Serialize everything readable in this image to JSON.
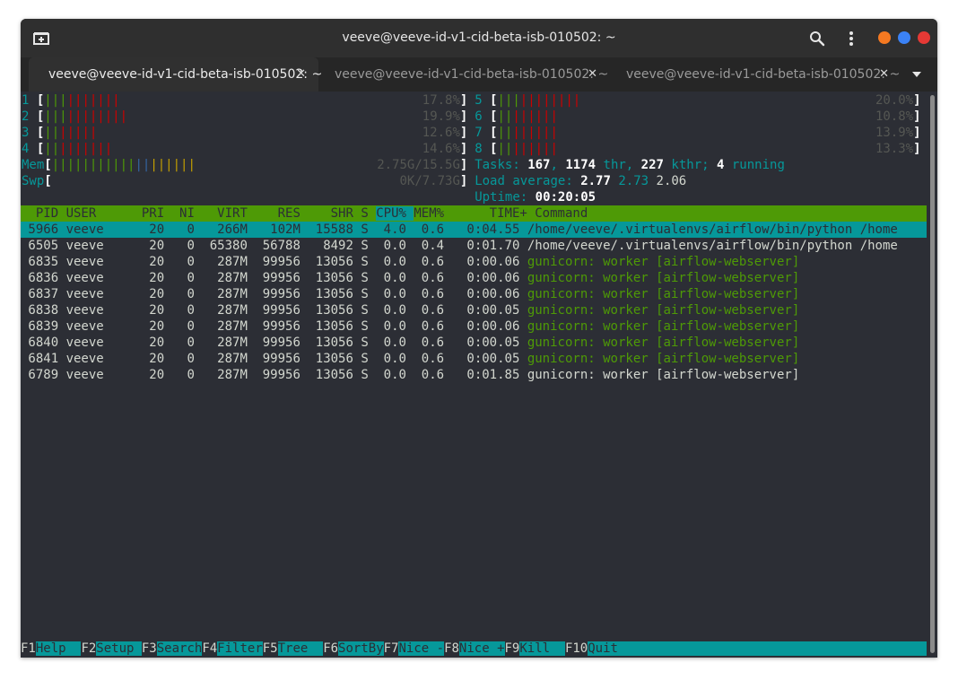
{
  "window": {
    "title": "veeve@veeve-id-v1-cid-beta-isb-010502: ~"
  },
  "tabs": [
    {
      "label": "veeve@veeve-id-v1-cid-beta-isb-010502: ~",
      "active": true
    },
    {
      "label": "veeve@veeve-id-v1-cid-beta-isb-010502: ~",
      "active": false
    },
    {
      "label": "veeve@veeve-id-v1-cid-beta-isb-010502: ~",
      "active": false
    }
  ],
  "icons": {
    "new_tab": "new-tab-icon",
    "search": "search-icon",
    "menu": "kebab-menu-icon",
    "tab_close": "close-icon",
    "tab_list": "caret-down-icon"
  },
  "colors": {
    "minimize": "#f57921",
    "maximize": "#3b82f6",
    "close": "#e53935"
  },
  "cpus": [
    {
      "id": "1",
      "green": 3,
      "red": 7,
      "percent": "17.8%"
    },
    {
      "id": "2",
      "green": 3,
      "red": 8,
      "percent": "19.9%"
    },
    {
      "id": "3",
      "green": 2,
      "red": 5,
      "percent": "12.6%"
    },
    {
      "id": "4",
      "green": 2,
      "red": 7,
      "percent": "14.6%"
    },
    {
      "id": "5",
      "green": 3,
      "red": 8,
      "percent": "20.0%"
    },
    {
      "id": "6",
      "green": 2,
      "red": 6,
      "percent": "10.8%"
    },
    {
      "id": "7",
      "green": 2,
      "red": 6,
      "percent": "13.9%"
    },
    {
      "id": "8",
      "green": 2,
      "red": 6,
      "percent": "13.3%"
    }
  ],
  "mem": {
    "label": "Mem",
    "green": 11,
    "blue": 2,
    "yellow": 6,
    "value": "2.75G/15.5G"
  },
  "swp": {
    "label": "Swp",
    "value": "0K/7.73G"
  },
  "tasks": {
    "label": "Tasks:",
    "count": "167",
    "thr": "1174",
    "thr_label": "thr,",
    "kthr": "227",
    "kthr_label": "kthr;",
    "running": "4",
    "running_label": "running"
  },
  "load": {
    "label": "Load average:",
    "v1": "2.77",
    "v2": "2.73",
    "v3": "2.06"
  },
  "uptime": {
    "label": "Uptime:",
    "value": "00:20:05"
  },
  "columns": [
    "PID",
    "USER",
    "PRI",
    "NI",
    "VIRT",
    "RES",
    "SHR",
    "S",
    "CPU%",
    "MEM%",
    "TIME+",
    "Command"
  ],
  "processes": [
    {
      "pid": "5966",
      "user": "veeve",
      "pri": "20",
      "ni": "0",
      "virt": "266M",
      "res": "102M",
      "shr": "15588",
      "s": "S",
      "cpu": "4.0",
      "mem": "0.6",
      "time": "0:04.55",
      "cmd": "/home/veeve/.virtualenvs/airflow/bin/python /home",
      "selected": true,
      "thread": false
    },
    {
      "pid": "6505",
      "user": "veeve",
      "pri": "20",
      "ni": "0",
      "virt": "65380",
      "res": "56788",
      "shr": "8492",
      "s": "S",
      "cpu": "0.0",
      "mem": "0.4",
      "time": "0:01.70",
      "cmd": "/home/veeve/.virtualenvs/airflow/bin/python /home",
      "selected": false,
      "thread": false
    },
    {
      "pid": "6835",
      "user": "veeve",
      "pri": "20",
      "ni": "0",
      "virt": "287M",
      "res": "99956",
      "shr": "13056",
      "s": "S",
      "cpu": "0.0",
      "mem": "0.6",
      "time": "0:00.06",
      "cmd": "gunicorn: worker [airflow-webserver]",
      "selected": false,
      "thread": true
    },
    {
      "pid": "6836",
      "user": "veeve",
      "pri": "20",
      "ni": "0",
      "virt": "287M",
      "res": "99956",
      "shr": "13056",
      "s": "S",
      "cpu": "0.0",
      "mem": "0.6",
      "time": "0:00.06",
      "cmd": "gunicorn: worker [airflow-webserver]",
      "selected": false,
      "thread": true
    },
    {
      "pid": "6837",
      "user": "veeve",
      "pri": "20",
      "ni": "0",
      "virt": "287M",
      "res": "99956",
      "shr": "13056",
      "s": "S",
      "cpu": "0.0",
      "mem": "0.6",
      "time": "0:00.06",
      "cmd": "gunicorn: worker [airflow-webserver]",
      "selected": false,
      "thread": true
    },
    {
      "pid": "6838",
      "user": "veeve",
      "pri": "20",
      "ni": "0",
      "virt": "287M",
      "res": "99956",
      "shr": "13056",
      "s": "S",
      "cpu": "0.0",
      "mem": "0.6",
      "time": "0:00.05",
      "cmd": "gunicorn: worker [airflow-webserver]",
      "selected": false,
      "thread": true
    },
    {
      "pid": "6839",
      "user": "veeve",
      "pri": "20",
      "ni": "0",
      "virt": "287M",
      "res": "99956",
      "shr": "13056",
      "s": "S",
      "cpu": "0.0",
      "mem": "0.6",
      "time": "0:00.06",
      "cmd": "gunicorn: worker [airflow-webserver]",
      "selected": false,
      "thread": true
    },
    {
      "pid": "6840",
      "user": "veeve",
      "pri": "20",
      "ni": "0",
      "virt": "287M",
      "res": "99956",
      "shr": "13056",
      "s": "S",
      "cpu": "0.0",
      "mem": "0.6",
      "time": "0:00.05",
      "cmd": "gunicorn: worker [airflow-webserver]",
      "selected": false,
      "thread": true
    },
    {
      "pid": "6841",
      "user": "veeve",
      "pri": "20",
      "ni": "0",
      "virt": "287M",
      "res": "99956",
      "shr": "13056",
      "s": "S",
      "cpu": "0.0",
      "mem": "0.6",
      "time": "0:00.05",
      "cmd": "gunicorn: worker [airflow-webserver]",
      "selected": false,
      "thread": true
    },
    {
      "pid": "6789",
      "user": "veeve",
      "pri": "20",
      "ni": "0",
      "virt": "287M",
      "res": "99956",
      "shr": "13056",
      "s": "S",
      "cpu": "0.0",
      "mem": "0.6",
      "time": "0:01.85",
      "cmd": "gunicorn: worker [airflow-webserver]",
      "selected": false,
      "thread": false
    }
  ],
  "function_keys": [
    {
      "key": "F1",
      "label": "Help  "
    },
    {
      "key": "F2",
      "label": "Setup "
    },
    {
      "key": "F3",
      "label": "Search"
    },
    {
      "key": "F4",
      "label": "Filter"
    },
    {
      "key": "F5",
      "label": "Tree  "
    },
    {
      "key": "F6",
      "label": "SortBy"
    },
    {
      "key": "F7",
      "label": "Nice -"
    },
    {
      "key": "F8",
      "label": "Nice +"
    },
    {
      "key": "F9",
      "label": "Kill  "
    },
    {
      "key": "F10",
      "label": "Quit  "
    }
  ]
}
